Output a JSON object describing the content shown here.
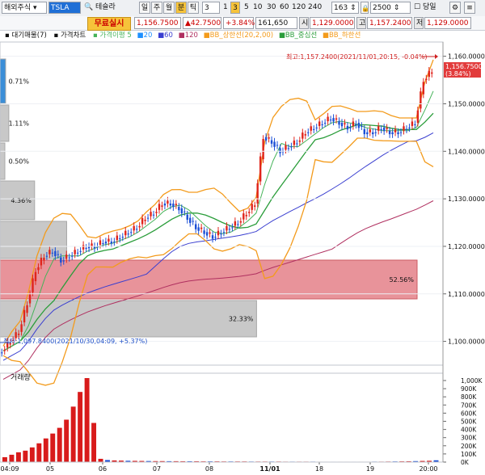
{
  "toolbar": {
    "market_select": "해외주식",
    "symbol_code": "TSLA",
    "symbol_name": "테슬라",
    "period_day": "일",
    "period_week": "주",
    "period_month": "월",
    "period_min": "분",
    "period_tick": "틱",
    "interval_value": "3",
    "interval_1": "1",
    "interval_3": "3",
    "interval_5": "5",
    "interval_10": "10",
    "interval_30": "30",
    "interval_60": "60",
    "interval_120": "120",
    "interval_240": "240",
    "count_value": "163",
    "range_value": "2500",
    "same_label": "당일",
    "free_realtime": "무료실시",
    "price": "1,156.7500",
    "change": "▲42.7500",
    "change_pct": "+3.84%",
    "volume": "161,650",
    "open_label": "시",
    "open_value": "1,129.0000",
    "high_label": "고",
    "high_value": "1,157.2400",
    "low_label": "저",
    "low_value": "1,129.0000",
    "colors": {
      "up": "#e0241b",
      "down": "#1b4fd6",
      "accent": "#f6c33a"
    }
  },
  "legend": {
    "daily_sell_label": "대기매물(7)",
    "price_chart_label": "가격차트",
    "ma_label": "가격이평",
    "ma_5": "5",
    "ma_20": "20",
    "ma_60": "60",
    "ma_120": "120",
    "bb_upper": "BB_상한선(20,2,00)",
    "bb_mid": "BB_중심선",
    "bb_lower": "BB_하한선",
    "colors": {
      "ma5": "#46b35a",
      "ma20": "#1e90ff",
      "ma60": "#3a3fd0",
      "ma120": "#b03060",
      "bb": "#f39b1c",
      "bbmid": "#2a9d3a"
    }
  },
  "annotations": {
    "high_marker": "최고:1,157.2400(2021/11/01,20:15, -0.04%)",
    "low_marker": "최저:1,097.8400(2021/10/30,04:09, +5.37%)",
    "current_price_tag": "1,156.7500",
    "current_pct_tag": "(3.84%)"
  },
  "volume_panel": {
    "label": "거래량",
    "ticks": [
      "1,000K",
      "900K",
      "800K",
      "700K",
      "600K",
      "500K",
      "400K",
      "300K",
      "200K",
      "100K",
      "0K"
    ]
  },
  "chart_data": {
    "type": "candlestick",
    "y_ticks": [
      "1,160.0000",
      "1,150.0000",
      "1,140.0000",
      "1,130.0000",
      "1,120.0000",
      "1,110.0000",
      "1,100.0000"
    ],
    "ylim": [
      1095,
      1163
    ],
    "x_ticks": [
      "04:09",
      "05",
      "06",
      "07",
      "08",
      "11/01",
      "18",
      "19",
      "20:00"
    ],
    "close_series": [
      1098,
      1100,
      1102,
      1108,
      1115,
      1118,
      1119,
      1117,
      1118,
      1119,
      1120,
      1120,
      1121,
      1121,
      1122,
      1123,
      1124,
      1126,
      1127,
      1129,
      1129,
      1128,
      1126,
      1124,
      1123,
      1122,
      1123,
      1124,
      1125,
      1127,
      1129,
      1143,
      1142,
      1140,
      1141,
      1142,
      1144,
      1145,
      1146,
      1147,
      1146,
      1145,
      1146,
      1144,
      1144,
      1145,
      1144,
      1144,
      1145,
      1146,
      1155,
      1157
    ],
    "volume_profile": [
      {
        "label": "0.71%",
        "value": 0.71
      },
      {
        "label": "1.11%",
        "value": 1.11
      },
      {
        "label": "0.50%",
        "value": 0.5
      },
      {
        "label": "4.36%",
        "value": 4.36
      },
      {
        "label": "",
        "value": 8.4
      },
      {
        "label": "52.56%",
        "value": 52.56
      },
      {
        "label": "32.33%",
        "value": 32.33
      }
    ],
    "volume_bars_k": [
      60,
      90,
      120,
      140,
      180,
      230,
      290,
      350,
      420,
      520,
      680,
      860,
      1030,
      480,
      40,
      25,
      20,
      18,
      16,
      15,
      14,
      13,
      12,
      12,
      11,
      11,
      10,
      10,
      10,
      9,
      9,
      9,
      8,
      8,
      8,
      8,
      7,
      7,
      7,
      7,
      7,
      6,
      6,
      6,
      6,
      6,
      5,
      5,
      5,
      5,
      5,
      5,
      5,
      5,
      6,
      6,
      7,
      8,
      9,
      10,
      12,
      14,
      16,
      22
    ]
  }
}
